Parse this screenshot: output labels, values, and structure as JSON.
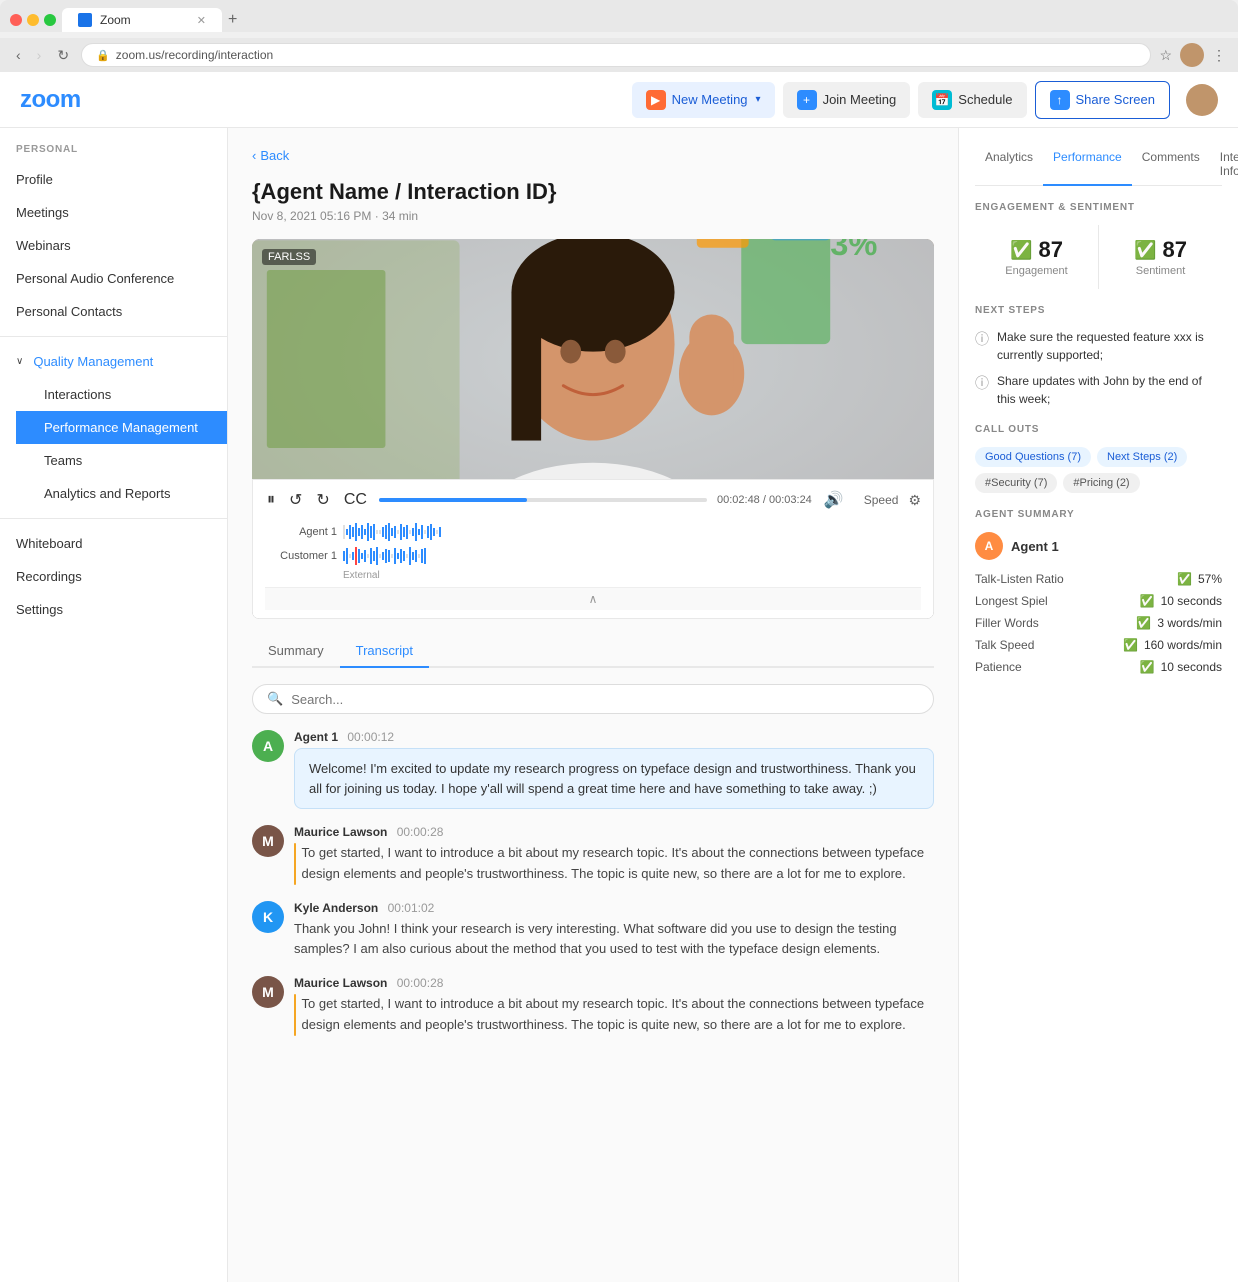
{
  "browser": {
    "tab_label": "Zoom",
    "address": "zoom.us/recording/interaction",
    "new_tab": "+",
    "nav": {
      "back": "‹",
      "forward": "›",
      "reload": "↻"
    }
  },
  "topbar": {
    "logo": "zoom",
    "buttons": {
      "new_meeting": "New Meeting",
      "join_meeting": "Join Meeting",
      "schedule": "Schedule",
      "share_screen": "Share Screen"
    },
    "chevron": "▾"
  },
  "sidebar": {
    "section_label": "PERSONAL",
    "items": [
      {
        "label": "Profile",
        "id": "profile"
      },
      {
        "label": "Meetings",
        "id": "meetings"
      },
      {
        "label": "Webinars",
        "id": "webinars"
      },
      {
        "label": "Personal Audio Conference",
        "id": "personal-audio"
      },
      {
        "label": "Personal Contacts",
        "id": "personal-contacts"
      },
      {
        "label": "Quality Management",
        "id": "quality-management",
        "expanded": true
      },
      {
        "label": "Interactions",
        "id": "interactions",
        "sub": true
      },
      {
        "label": "Performance Management",
        "id": "performance-management",
        "sub": true,
        "active": true
      },
      {
        "label": "Teams",
        "id": "teams",
        "sub": true
      },
      {
        "label": "Analytics and Reports",
        "id": "analytics-reports",
        "sub": true
      },
      {
        "label": "Whiteboard",
        "id": "whiteboard"
      },
      {
        "label": "Recordings",
        "id": "recordings"
      },
      {
        "label": "Settings",
        "id": "settings"
      }
    ]
  },
  "content": {
    "back_label": "Back",
    "title": "{Agent Name / Interaction ID}",
    "subtitle": "Nov 8, 2021 05:16 PM · 34 min",
    "tabs": [
      {
        "label": "Summary",
        "id": "summary"
      },
      {
        "label": "Transcript",
        "id": "transcript",
        "active": true
      }
    ],
    "search_placeholder": "Search...",
    "player": {
      "current_time": "00:02:48",
      "total_time": "00:03:24",
      "speed_label": "Speed",
      "agent_label": "Agent 1",
      "customer_label": "Customer 1",
      "external_label": "External"
    },
    "messages": [
      {
        "sender": "Agent 1",
        "avatar_letter": "A",
        "avatar_color": "green",
        "time": "00:00:12",
        "text": "Welcome! I'm excited to update my research progress on typeface design and trustworthiness. Thank you all for joining us today. I hope y'all will spend a great time here and have something to take away. ;)",
        "bubble": true
      },
      {
        "sender": "Maurice Lawson",
        "avatar_letter": "M",
        "avatar_color": "brown",
        "time": "00:00:28",
        "text": "To get started, I want to introduce a bit about my research topic. It's about the connections between typeface design elements and people's trustworthiness. The topic is quite new, so there are a lot for me to explore.",
        "bubble": false
      },
      {
        "sender": "Kyle Anderson",
        "avatar_letter": "K",
        "avatar_color": "blue",
        "time": "00:01:02",
        "text": "Thank you John! I think your research is very interesting. What software did you use to design the testing samples? I am also curious about the method that you used to test with the typeface design elements.",
        "bubble": false
      },
      {
        "sender": "Maurice Lawson",
        "avatar_letter": "M",
        "avatar_color": "brown",
        "time": "00:00:28",
        "text": "To get started, I want to introduce a bit about my research topic. It's about the connections between typeface design elements and people's trustworthiness. The topic is quite new, so there are a lot for me to explore.",
        "bubble": false
      }
    ]
  },
  "right_panel": {
    "tabs": [
      {
        "label": "Analytics",
        "id": "analytics"
      },
      {
        "label": "Performance",
        "id": "performance",
        "active": true
      },
      {
        "label": "Comments",
        "id": "comments"
      },
      {
        "label": "Interaction Info",
        "id": "interaction-info"
      }
    ],
    "engagement_section": "ENGAGEMENT & SENTIMENT",
    "engagement": {
      "score": "87",
      "label": "Engagement"
    },
    "sentiment": {
      "score": "87",
      "label": "Sentiment"
    },
    "next_steps_section": "NEXT STEPS",
    "next_steps": [
      "Make sure the requested feature xxx is currently supported;",
      "Share updates with John by the end of this week;"
    ],
    "callouts_section": "CALL OUTS",
    "callout_tags": [
      {
        "label": "Good Questions (7)",
        "type": "blue"
      },
      {
        "label": "Next Steps (2)",
        "type": "blue"
      },
      {
        "label": "#Security (7)",
        "type": "gray"
      },
      {
        "label": "#Pricing (2)",
        "type": "gray"
      }
    ],
    "agent_summary_section": "AGENT SUMMARY",
    "agent_name": "Agent 1",
    "metrics": [
      {
        "label": "Talk-Listen Ratio",
        "value": "57%"
      },
      {
        "label": "Longest Spiel",
        "value": "10 seconds"
      },
      {
        "label": "Filler Words",
        "value": "3 words/min"
      },
      {
        "label": "Talk Speed",
        "value": "160 words/min"
      },
      {
        "label": "Patience",
        "value": "10 seconds"
      }
    ]
  }
}
